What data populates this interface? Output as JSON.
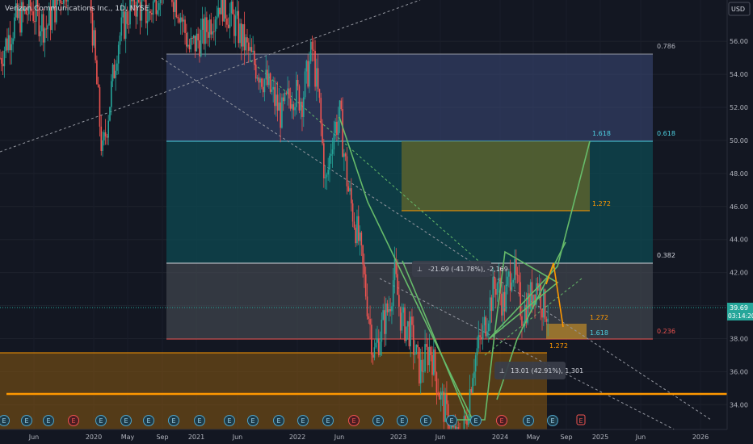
{
  "header": {
    "title": "Verizon Communications Inc., 1D, NYSE",
    "currency": "USD"
  },
  "colors": {
    "background": "#131722",
    "candle_up": "#26a69a",
    "candle_down": "#ef5350",
    "fib_top_zone": "#3c4a7a",
    "fib_mid_zone": "#0e4a52",
    "fib_low_zone": "#4a4f57",
    "orange": "#ff9800",
    "green_line": "#66bb6a",
    "price_badge": "#26a69a"
  },
  "price_axis": {
    "ticks": [
      "56.00",
      "54.00",
      "52.00",
      "50.00",
      "48.00",
      "46.00",
      "44.00",
      "42.00",
      "40.00",
      "38.00",
      "36.00",
      "34.00"
    ],
    "current_price": "39.69",
    "countdown": "03:14:20"
  },
  "time_axis": {
    "labels": [
      "Jun",
      "2020",
      "May",
      "Sep",
      "2021",
      "Jun",
      "2022",
      "Jun",
      "2023",
      "Jun",
      "2024",
      "May",
      "Sep",
      "2025",
      "Jun",
      "2026"
    ]
  },
  "fib_levels": {
    "l0786": "0.786",
    "l0618": "0.618",
    "l0382": "0.382",
    "l0236": "0.236"
  },
  "extension_labels": {
    "big_1618": "1.618",
    "big_1272": "1.272",
    "small_1272": "1.272",
    "small_1618": "1.618",
    "below_1272": "1.272"
  },
  "measure_1": {
    "icon": "⊥",
    "text": "-21.69 (-41.78%), -2,169"
  },
  "measure_2": {
    "icon": "⊥",
    "text": "13.01 (42.91%), 1,301"
  },
  "events": {
    "earnings_letter": "E"
  },
  "chart_data": {
    "type": "candlestick",
    "title": "Verizon Communications Inc., 1D, NYSE",
    "ylim": [
      32.5,
      58.5
    ],
    "y_ticks": [
      34,
      36,
      38,
      40,
      42,
      44,
      46,
      48,
      50,
      52,
      54,
      56
    ],
    "x_labels": [
      "Jun",
      "2020",
      "May",
      "Sep",
      "2021",
      "Jun",
      "2022",
      "Jun",
      "2023",
      "Jun",
      "2024",
      "May",
      "Sep",
      "2025",
      "Jun",
      "2026"
    ],
    "price_path": [
      [
        2019.2,
        55.0
      ],
      [
        2019.35,
        57.2
      ],
      [
        2019.5,
        58.0
      ],
      [
        2019.65,
        56.8
      ],
      [
        2019.8,
        59.0
      ],
      [
        2019.95,
        60.5
      ],
      [
        2020.05,
        61.0
      ],
      [
        2020.2,
        49.0
      ],
      [
        2020.35,
        56.0
      ],
      [
        2020.5,
        58.5
      ],
      [
        2020.65,
        57.5
      ],
      [
        2020.8,
        60.0
      ],
      [
        2020.95,
        58.0
      ],
      [
        2021.05,
        55.5
      ],
      [
        2021.2,
        56.5
      ],
      [
        2021.35,
        58.5
      ],
      [
        2021.5,
        57.0
      ],
      [
        2021.65,
        55.0
      ],
      [
        2021.8,
        53.5
      ],
      [
        2021.95,
        51.5
      ],
      [
        2022.05,
        53.0
      ],
      [
        2022.15,
        52.5
      ],
      [
        2022.25,
        55.5
      ],
      [
        2022.32,
        52.0
      ],
      [
        2022.38,
        47.0
      ],
      [
        2022.45,
        50.5
      ],
      [
        2022.52,
        51.5
      ],
      [
        2022.6,
        47.0
      ],
      [
        2022.7,
        44.0
      ],
      [
        2022.78,
        40.5
      ],
      [
        2022.85,
        37.0
      ],
      [
        2022.92,
        38.5
      ],
      [
        2023.0,
        40.0
      ],
      [
        2023.05,
        42.0
      ],
      [
        2023.12,
        39.0
      ],
      [
        2023.2,
        38.5
      ],
      [
        2023.3,
        36.0
      ],
      [
        2023.4,
        37.5
      ],
      [
        2023.5,
        34.5
      ],
      [
        2023.6,
        32.5
      ],
      [
        2023.68,
        31.5
      ],
      [
        2023.75,
        33.0
      ],
      [
        2023.82,
        36.5
      ],
      [
        2023.9,
        38.0
      ],
      [
        2024.0,
        40.5
      ],
      [
        2024.05,
        41.5
      ],
      [
        2024.12,
        40.0
      ],
      [
        2024.2,
        42.5
      ],
      [
        2024.3,
        39.5
      ],
      [
        2024.38,
        40.5
      ],
      [
        2024.45,
        41.5
      ],
      [
        2024.5,
        40.0
      ],
      [
        2024.55,
        39.7
      ]
    ],
    "current_price": 39.69,
    "fib_levels": [
      {
        "level": "0.786",
        "price": 55.5
      },
      {
        "level": "0.618",
        "price": 50.1
      },
      {
        "level": "0.382",
        "price": 42.55
      },
      {
        "level": "0.236",
        "price": 37.85
      }
    ],
    "extension_box": {
      "top": 50.1,
      "bottom": 45.8,
      "labels": [
        "1.618",
        "1.272"
      ]
    },
    "small_box": {
      "top": 38.75,
      "bottom": 37.85,
      "labels": [
        "1.272",
        "1.618"
      ]
    },
    "support_zone": {
      "top": 36.9,
      "bottom": 32.5
    },
    "support_line": 34.35,
    "measurements": [
      "-21.69 (-41.78%), -2,169",
      "13.01 (42.91%), 1,301"
    ]
  }
}
